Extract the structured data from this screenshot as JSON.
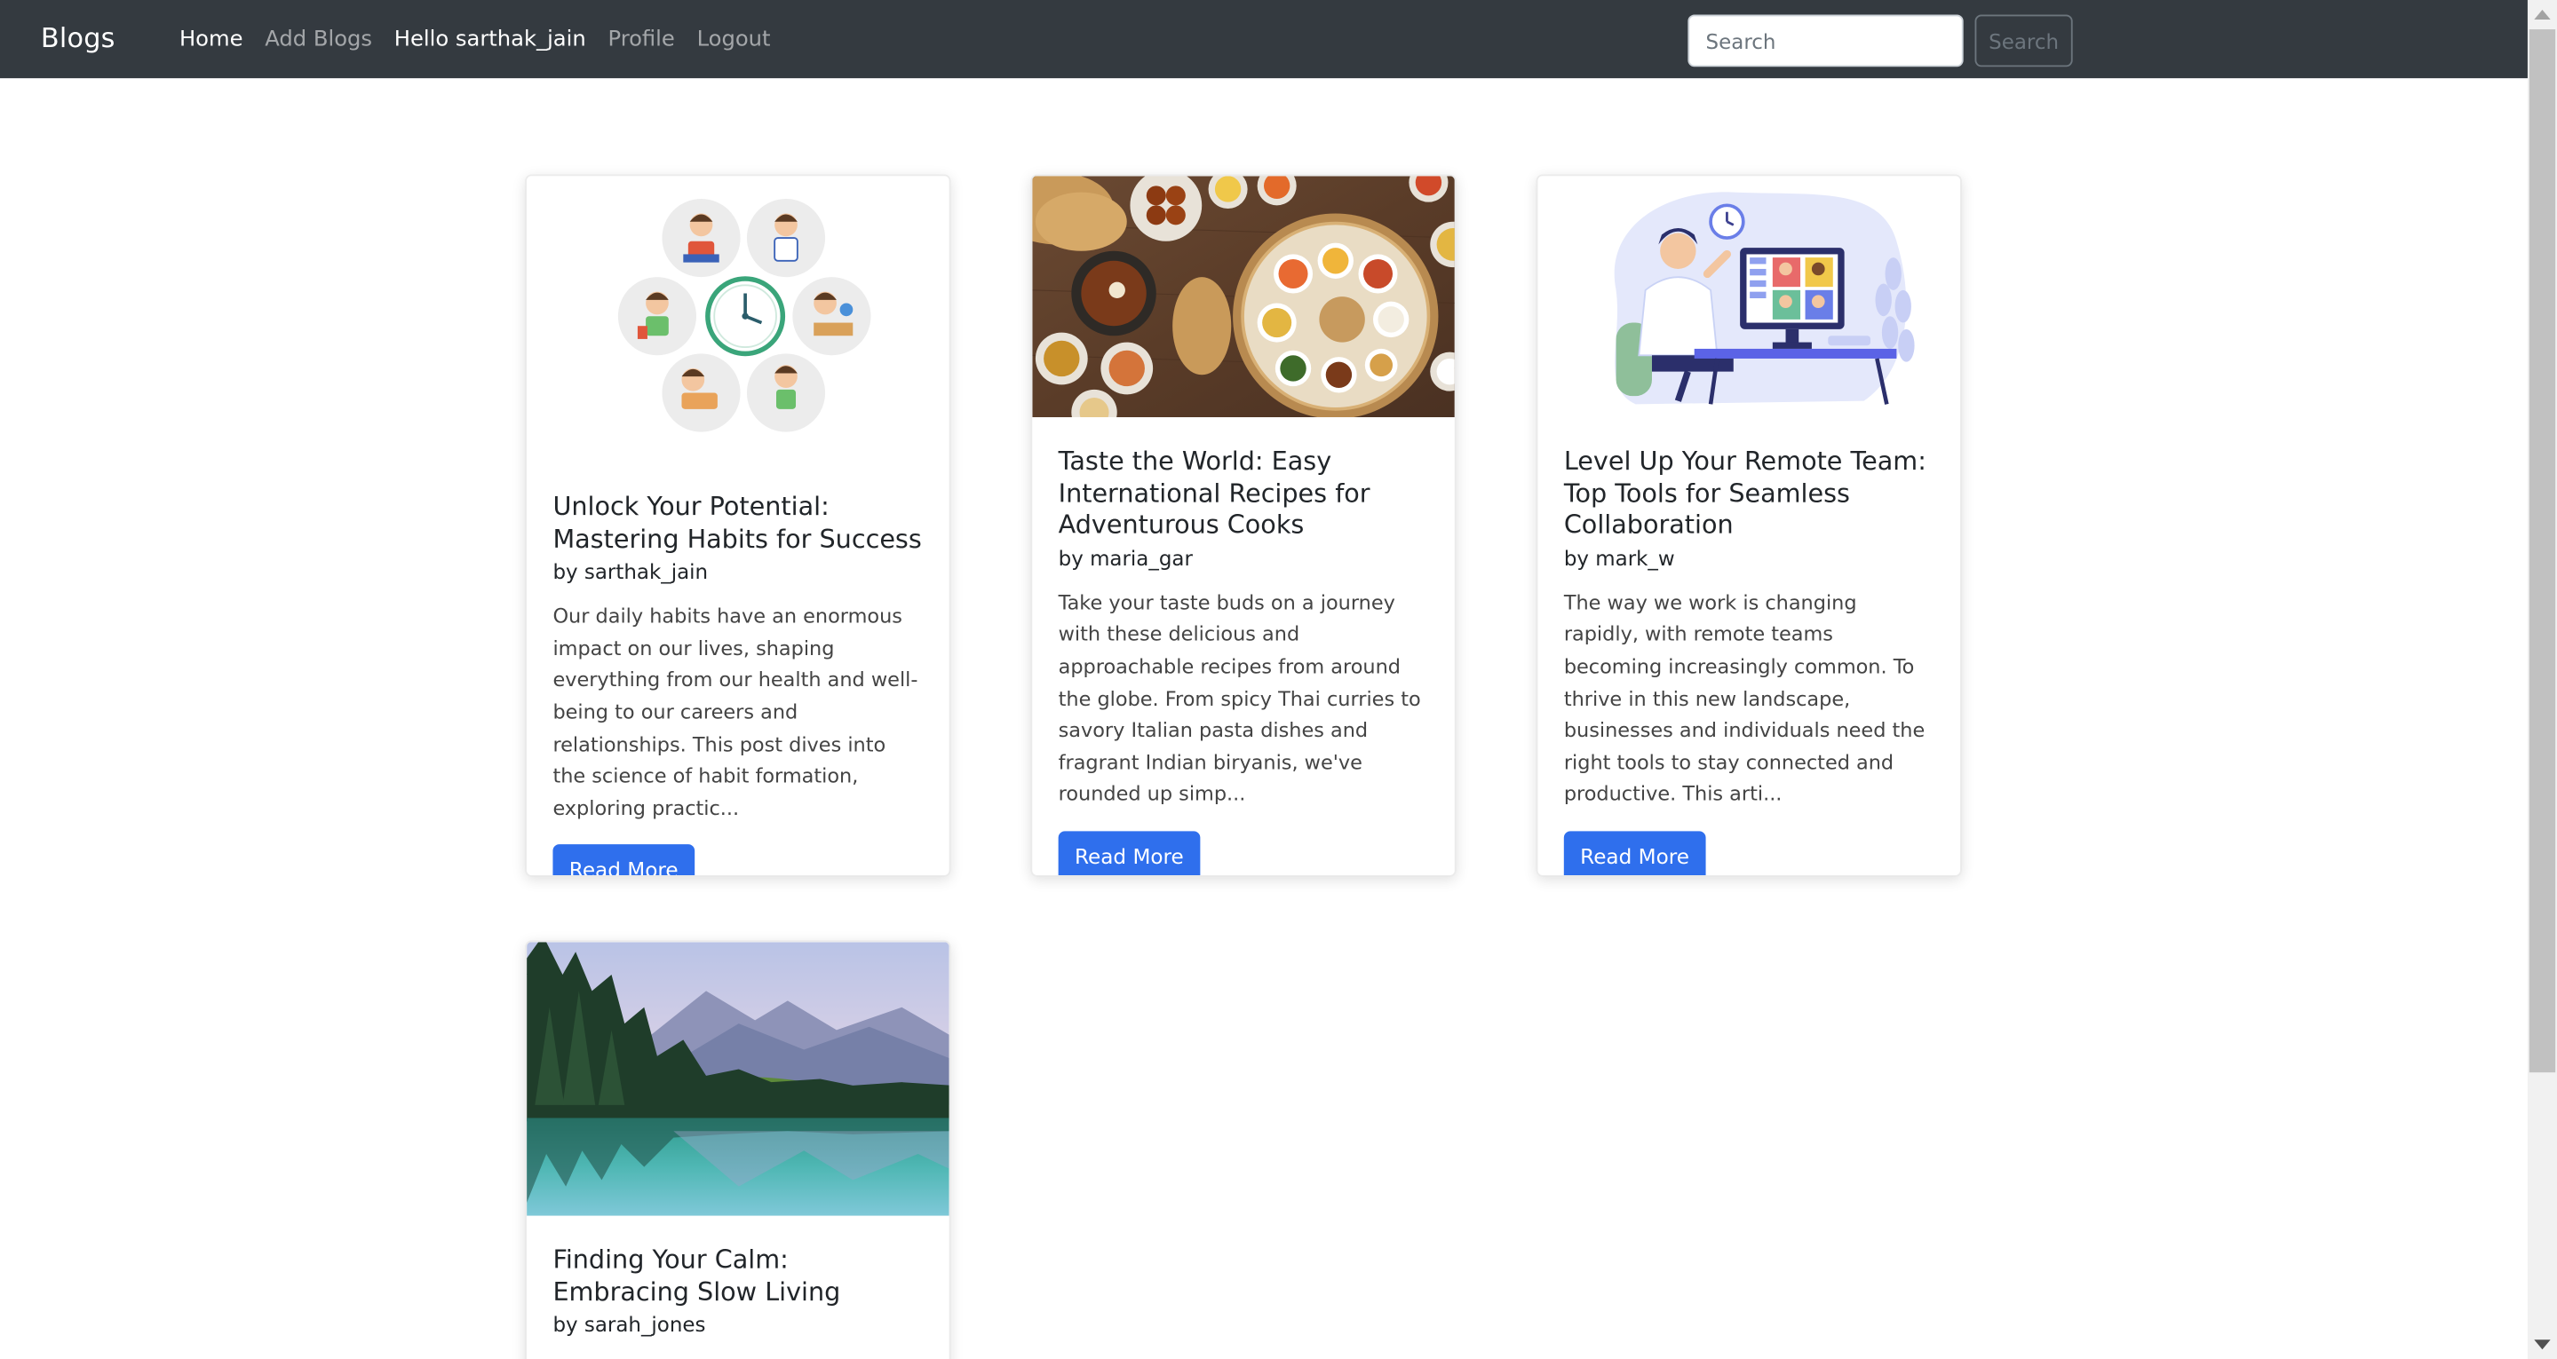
{
  "navbar": {
    "brand": "Blogs",
    "links": [
      {
        "label": "Home"
      },
      {
        "label": "Add Blogs"
      },
      {
        "label": "Hello sarthak_jain"
      },
      {
        "label": "Profile"
      },
      {
        "label": "Logout"
      }
    ],
    "search": {
      "placeholder": "Search",
      "value": "",
      "button_label": "Search"
    }
  },
  "posts": [
    {
      "title": "Unlock Your Potential: Mastering Habits for Success",
      "author": "by sarthak_jain",
      "excerpt": "Our daily habits have an enormous impact on our lives, shaping everything from our health and well-being to our careers and relationships. This post dives into the science of habit formation, exploring practic...",
      "button_label": "Read More",
      "image": "daily-routine-illustration"
    },
    {
      "title": "Taste the World: Easy International Recipes for Adventurous Cooks",
      "author": "by maria_gar",
      "excerpt": "Take your taste buds on a journey with these delicious and approachable recipes from around the globe. From spicy Thai curries to savory Italian pasta dishes and fragrant Indian biryanis, we've rounded up simp...",
      "button_label": "Read More",
      "image": "indian-thali-photo"
    },
    {
      "title": "Level Up Your Remote Team: Top Tools for Seamless Collaboration",
      "author": "by mark_w",
      "excerpt": "The way we work is changing rapidly, with remote teams becoming increasingly common. To thrive in this new landscape, businesses and individuals need the right tools to stay connected and productive. This arti...",
      "button_label": "Read More",
      "image": "remote-work-illustration"
    },
    {
      "title": "Finding Your Calm: Embracing Slow Living",
      "author": "by sarah_jones",
      "image": "mountain-lake-photo"
    }
  ]
}
